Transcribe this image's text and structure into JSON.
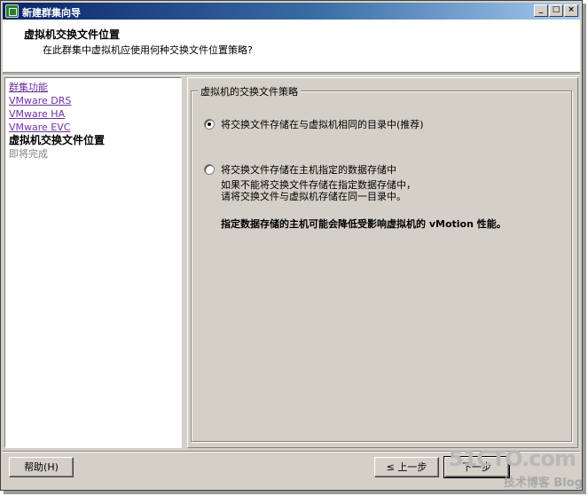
{
  "window": {
    "title": "新建群集向导"
  },
  "header": {
    "title": "虚拟机交换文件位置",
    "subtitle": "在此群集中虚拟机应使用何种交换文件位置策略?"
  },
  "sidebar": {
    "items": [
      {
        "label": "群集功能",
        "state": "link"
      },
      {
        "label": "VMware DRS",
        "state": "link"
      },
      {
        "label": "VMware HA",
        "state": "link"
      },
      {
        "label": "VMware EVC",
        "state": "link"
      },
      {
        "label": "虚拟机交换文件位置",
        "state": "current"
      },
      {
        "label": "即将完成",
        "state": "pending"
      }
    ]
  },
  "policy": {
    "group_label": "虚拟机的交换文件策略",
    "option1_label": "将交换文件存储在与虚拟机相同的目录中(推荐)",
    "option2_label": "将交换文件存储在主机指定的数据存储中",
    "option2_desc_line1": "如果不能将交换文件存储在指定数据存储中，",
    "option2_desc_line2": "请将交换文件与虚拟机存储在同一目录中。",
    "warning": "指定数据存储的主机可能会降低受影响虚拟机的 vMotion 性能。",
    "selected": "option1"
  },
  "buttons": {
    "help": "帮助(H)",
    "back": "≤ 上一步",
    "next": "下一步"
  },
  "watermark": {
    "site": "51CTO.com",
    "tagline": "技术博客 Blog"
  }
}
